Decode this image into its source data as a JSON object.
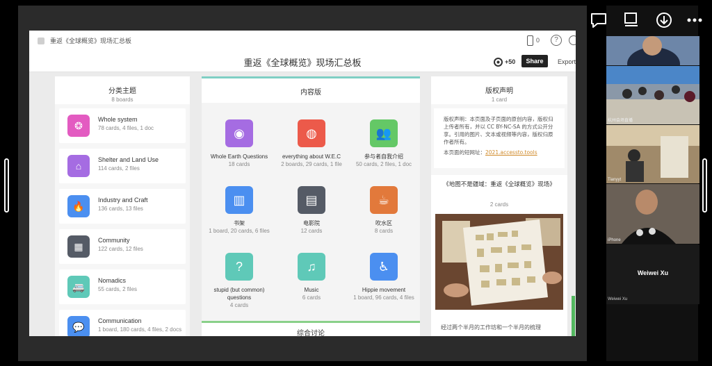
{
  "app_bar": {
    "title": "重返《全球概览》现场汇总板",
    "phone_count": "0",
    "help": "?"
  },
  "board": {
    "title": "重返《全球概览》现场汇总板",
    "viewers": "+50",
    "share_label": "Share",
    "export_label": "Export"
  },
  "left_column": {
    "title": "分类主题",
    "subtitle": "8 boards",
    "items": [
      {
        "label": "Whole system",
        "meta": "78 cards, 4 files, 1 doc",
        "color": "#e35bc1",
        "icon": "❂"
      },
      {
        "label": "Shelter and Land Use",
        "meta": "114 cards, 2 files",
        "color": "#a56ce2",
        "icon": "⌂"
      },
      {
        "label": "Industry and Craft",
        "meta": "136 cards, 13 files",
        "color": "#4b8ff0",
        "icon": "🔥"
      },
      {
        "label": "Community",
        "meta": "122 cards, 12 files",
        "color": "#555b66",
        "icon": "▦"
      },
      {
        "label": "Nomadics",
        "meta": "55 cards, 2 files",
        "color": "#5fc9b8",
        "icon": "🚐"
      },
      {
        "label": "Communication",
        "meta": "1 board, 180 cards, 4 files, 2 docs",
        "color": "#4b8ff0",
        "icon": "💬"
      }
    ]
  },
  "middle_column": {
    "title": "内容版",
    "footer_title": "综合讨论",
    "tiles": [
      {
        "label": "Whole Earth Questions",
        "meta": "18 cards",
        "color": "#a56ce2",
        "icon": "◉"
      },
      {
        "label": "everything about W.E.C",
        "meta": "2 boards, 29 cards, 1 file",
        "color": "#ec5a4a",
        "icon": "◍"
      },
      {
        "label": "参与者自我介绍",
        "meta": "50 cards, 2 files, 1 doc",
        "color": "#64c866",
        "icon": "👥"
      },
      {
        "label": "书架",
        "meta": "1 board, 20 cards, 6 files",
        "color": "#4b8ff0",
        "icon": "▥"
      },
      {
        "label": "电影院",
        "meta": "12 cards",
        "color": "#555b66",
        "icon": "▤"
      },
      {
        "label": "吹水区",
        "meta": "8 cards",
        "color": "#e2793b",
        "icon": "☕"
      },
      {
        "label": "stupid (but common) questions",
        "meta": "4 cards",
        "color": "#5fc9b8",
        "icon": "?"
      },
      {
        "label": "Music",
        "meta": "6 cards",
        "color": "#5fc9b8",
        "icon": "♫"
      },
      {
        "label": "Hippie movement",
        "meta": "1 board, 96 cards, 4 files",
        "color": "#4b8ff0",
        "icon": "♿"
      }
    ]
  },
  "right_column": {
    "title": "版权声明",
    "subtitle": "1 card",
    "copyright_text": "版权声明：本页面及子页面的原创内容，版权归上传者所有，并以 CC BY-NC-SA 的方式公开分享。引用的图片、文本或视频等内容，版权归原作者所有。",
    "link_prefix": "本页面的短网址：",
    "link": "2021.accessto.tools",
    "card_title": "《地图不是疆域：重返《全球概览》现场》",
    "card_subtitle": "2 cards",
    "card_footer": "经过两个半月的工作坊和一个半月的梳理"
  },
  "side_panel": {
    "controls": [
      "chat-icon",
      "screen-icon",
      "download-icon",
      "more-icon"
    ],
    "participants": [
      {
        "name": ""
      },
      {
        "name": "杭州会场直播"
      },
      {
        "name": "Tianyyt"
      },
      {
        "name": "iPhone"
      }
    ],
    "speaker_name": "Weiwei Xu",
    "speaker_small": "Weiwei Xu"
  }
}
